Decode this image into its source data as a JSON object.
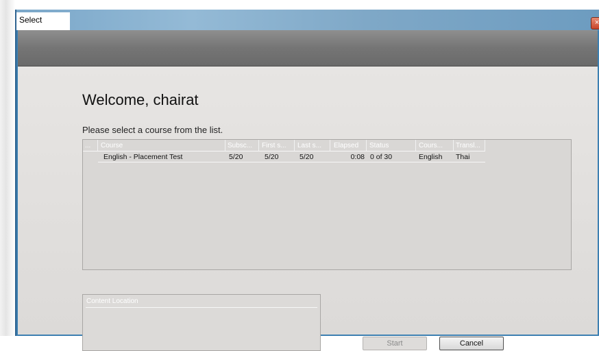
{
  "window": {
    "title": "Select",
    "close_glyph": "×"
  },
  "welcome": "Welcome, chairat",
  "subtitle": "Please select a course from the list.",
  "course_list": {
    "columns": [
      "...",
      "Course",
      "Subsc...",
      "First s...",
      "Last s...",
      "Elapsed",
      "Status",
      "Cours...",
      "Transl..."
    ],
    "rows": [
      {
        "course": "English - Placement Test",
        "subscribed": "5/20",
        "first": "5/20",
        "last": "5/20",
        "elapsed": "0:08",
        "status": "0 of 30",
        "course_lang": "English",
        "translation": "Thai"
      }
    ]
  },
  "content_location": {
    "label": "Content Location"
  },
  "buttons": {
    "start": "Start",
    "cancel": "Cancel"
  },
  "icons": {
    "close": "close-icon"
  }
}
